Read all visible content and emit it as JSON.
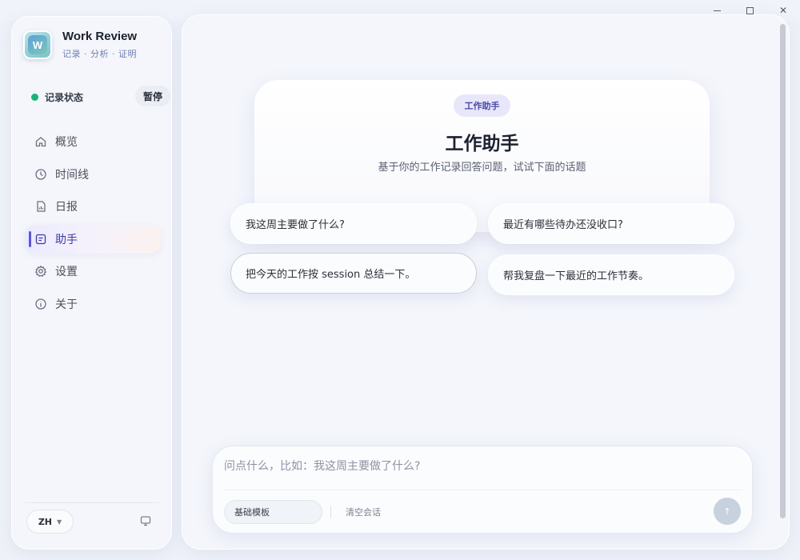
{
  "window": {
    "minimize_glyph": "",
    "maximize_glyph": "",
    "close_glyph": "✕"
  },
  "sidebar": {
    "brand_title": "Work Review",
    "brand_subtitle": "记录 · 分析 · 证明",
    "logo_glyph": "W",
    "record_status_label": "记录状态",
    "record_status_color": "#16b37a",
    "pause_label": "暂停",
    "items": [
      {
        "label": "概览",
        "icon": "home-icon"
      },
      {
        "label": "时间线",
        "icon": "clock-icon"
      },
      {
        "label": "日报",
        "icon": "report-icon"
      },
      {
        "label": "助手",
        "icon": "assistant-icon",
        "active": true
      },
      {
        "label": "设置",
        "icon": "gear-icon"
      },
      {
        "label": "关于",
        "icon": "info-icon"
      }
    ],
    "language": "ZH",
    "accent_color": "#5b55e0"
  },
  "main": {
    "badge": "工作助手",
    "title": "工作助手",
    "subtitle": "基于你的工作记录回答问题，试试下面的话题",
    "suggestions": [
      "我这周主要做了什么?",
      "最近有哪些待办还没收口?",
      "把今天的工作按 session 总结一下。",
      "帮我复盘一下最近的工作节奏。"
    ]
  },
  "composer": {
    "placeholder": "问点什么，比如：我这周主要做了什么?",
    "value": "",
    "template_label": "基础模板",
    "clear_label": "清空会话",
    "send_glyph": "↑"
  }
}
